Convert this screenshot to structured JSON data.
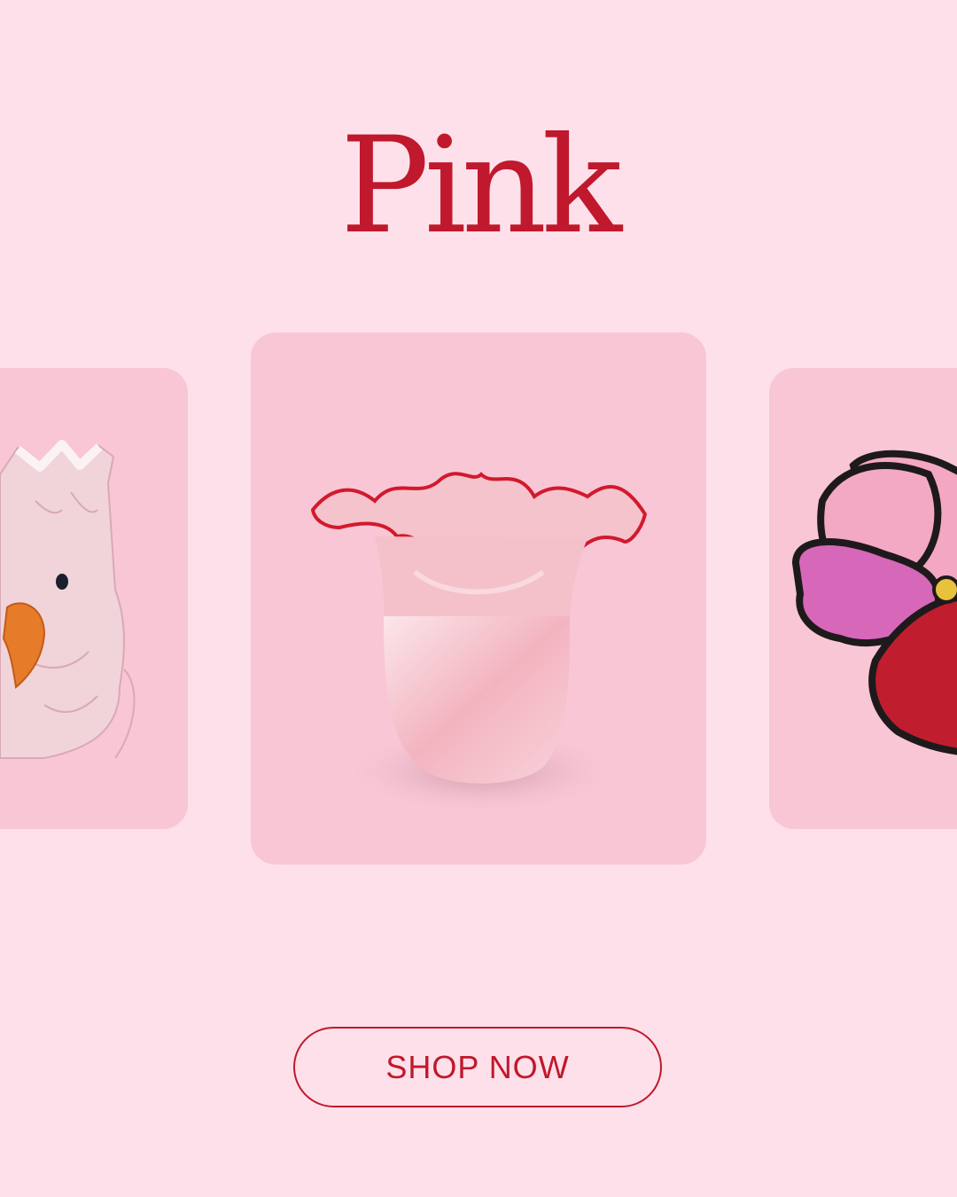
{
  "header": {
    "title": "Pink"
  },
  "products": [
    {
      "name": "cockatoo-vase-image"
    },
    {
      "name": "ruffled-glass-vase-image"
    },
    {
      "name": "beaded-flower-brooch-image"
    }
  ],
  "cta": {
    "label": "SHOP NOW"
  },
  "colors": {
    "background": "#fde0ea",
    "card": "#f9c6d6",
    "accent": "#c0182c"
  }
}
